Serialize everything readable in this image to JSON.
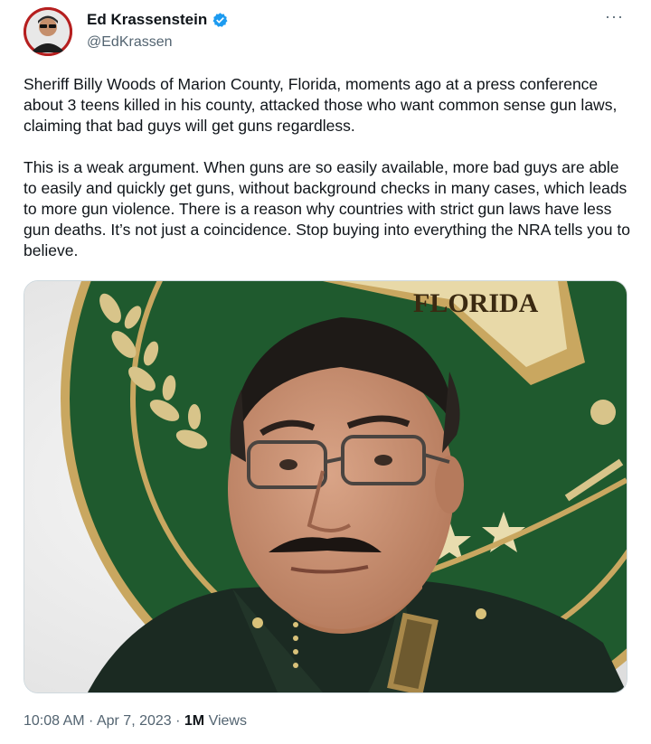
{
  "author": {
    "display_name": "Ed Krassenstein",
    "handle": "@EdKrassen",
    "verified": true,
    "avatar_icon": "user-avatar-icon",
    "verified_icon": "verified-badge-icon"
  },
  "more_icon_label": "···",
  "tweet": {
    "paragraphs": [
      "Sheriff Billy Woods of Marion County, Florida, moments ago at a press conference about 3 teens killed in his county, attacked those who want common sense gun laws, claiming that bad guys will get guns regardless.",
      "This is a weak argument. When guns are so easily available, more bad guys are able to easily and quickly get guns, without background checks in many cases, which leads to more gun violence.  There is a reason why countries with strict gun laws have less gun deaths.  It’s not just a coincidence. Stop buying into everything the NRA tells you to believe."
    ]
  },
  "media": {
    "seal_text": "FLORIDA",
    "colors": {
      "seal_green": "#1f5a2e",
      "seal_gold": "#c9a760",
      "uniform": "#1b2a22"
    }
  },
  "meta": {
    "time": "10:08 AM",
    "separator": " · ",
    "date": "Apr 7, 2023",
    "views_count": "1M",
    "views_label": " Views"
  },
  "colors": {
    "text_primary": "#0f1419",
    "text_secondary": "#536471",
    "verified_blue": "#1d9bf0"
  }
}
